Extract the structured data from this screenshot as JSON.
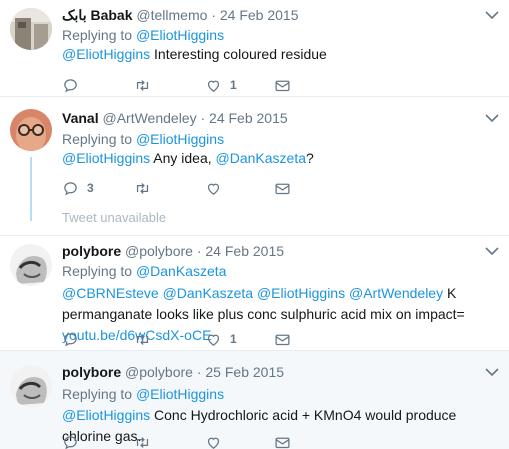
{
  "tweets": [
    {
      "name": "بابک Babak",
      "handle": "@tellmemo",
      "date": "24 Feb 2015",
      "replying_prefix": "Replying to",
      "replying_to": "@EliotHiggins",
      "mentions": [
        "@EliotHiggins"
      ],
      "text": " Interesting coloured residue",
      "reply_count": "",
      "retweet_count": "",
      "like_count": "1"
    },
    {
      "name": "Vanal",
      "handle": "@ArtWendeley",
      "date": "24 Feb 2015",
      "replying_prefix": "Replying to",
      "replying_to": "@EliotHiggins",
      "mention1": "@EliotHiggins",
      "text_mid": " Any idea, ",
      "mention2": "@DanKaszeta",
      "text_end": "?",
      "reply_count": "3",
      "retweet_count": "",
      "like_count": ""
    },
    {
      "name": "polybore",
      "handle": "@polybore",
      "date": "24 Feb 2015",
      "replying_prefix": "Replying to",
      "replying_to": "@DanKaszeta",
      "mentions": [
        "@CBRNEsteve",
        "@DanKaszeta",
        "@EliotHiggins",
        "@ArtWendeley"
      ],
      "text": " K permanganate looks like plus conc sulphuric acid mix on impact= ",
      "url": "youtu.be/d6wCsdX-oCE",
      "reply_count": "",
      "retweet_count": "",
      "like_count": "1"
    },
    {
      "name": "polybore",
      "handle": "@polybore",
      "date": "25 Feb 2015",
      "replying_prefix": "Replying to",
      "replying_to": "@EliotHiggins",
      "mention": "@EliotHiggins",
      "text": " Conc Hydrochloric acid + KMnO4 would produce chlorine gas.",
      "reply_count": "",
      "retweet_count": "",
      "like_count": ""
    }
  ],
  "unavailable_text": "Tweet unavailable",
  "separator": "·",
  "icons": {
    "reply": "reply-icon",
    "retweet": "retweet-icon",
    "like": "heart-icon",
    "dm": "envelope-icon",
    "menu": "chevron-down-icon"
  },
  "colors": {
    "link": "#1b95e0",
    "muted": "#657786",
    "thread_line": "#b6dff7",
    "highlight_bg": "#f5f8fa"
  }
}
